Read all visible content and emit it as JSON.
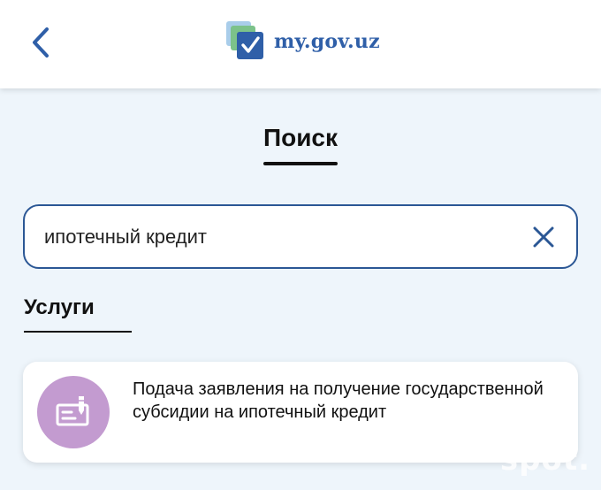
{
  "header": {
    "back_icon": "chevron-left-icon",
    "logo_icon": "checkmark-documents-icon",
    "logo_text": "my.gov.uz"
  },
  "page": {
    "title": "Поиск"
  },
  "search": {
    "value": "ипотечный кредит",
    "clear_icon": "close-icon"
  },
  "services": {
    "section_title": "Услуги",
    "items": [
      {
        "icon": "application-form-icon",
        "label": "Подача заявления на получение государственной субсидии на ипотечный кредит"
      }
    ]
  },
  "watermark": "spot.",
  "colors": {
    "accent": "#2b5795",
    "logo_text": "#2f5fa8",
    "background": "#eef5fb",
    "service_icon_bg": "#c39bd0"
  }
}
